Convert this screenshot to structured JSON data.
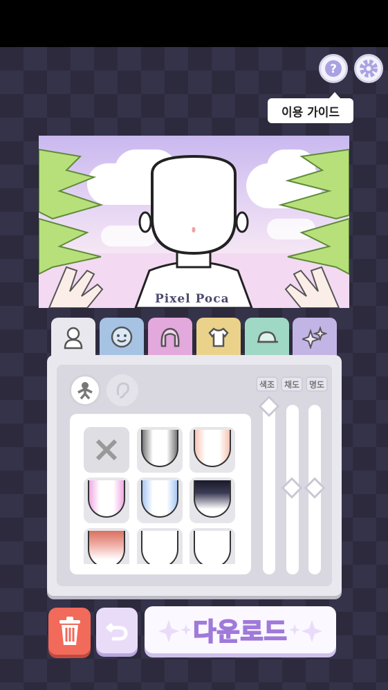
{
  "guide": {
    "label": "이용 가이드"
  },
  "scene": {
    "shirt_text": "Pixel Poca"
  },
  "tabs": [
    {
      "icon": "body-icon",
      "selected": true
    },
    {
      "icon": "face-icon",
      "selected": false
    },
    {
      "icon": "hair-icon",
      "selected": false
    },
    {
      "icon": "shirt-icon",
      "selected": false
    },
    {
      "icon": "cap-icon",
      "selected": false
    },
    {
      "icon": "sparkle-icon",
      "selected": false
    }
  ],
  "sliders": {
    "hue": "색조",
    "saturation": "채도",
    "brightness": "명도"
  },
  "actions": {
    "download": "다운로드"
  },
  "colors": {
    "accent": "#9f7ad9",
    "trash": "#f26a5a",
    "background": "#2c2a3c"
  }
}
